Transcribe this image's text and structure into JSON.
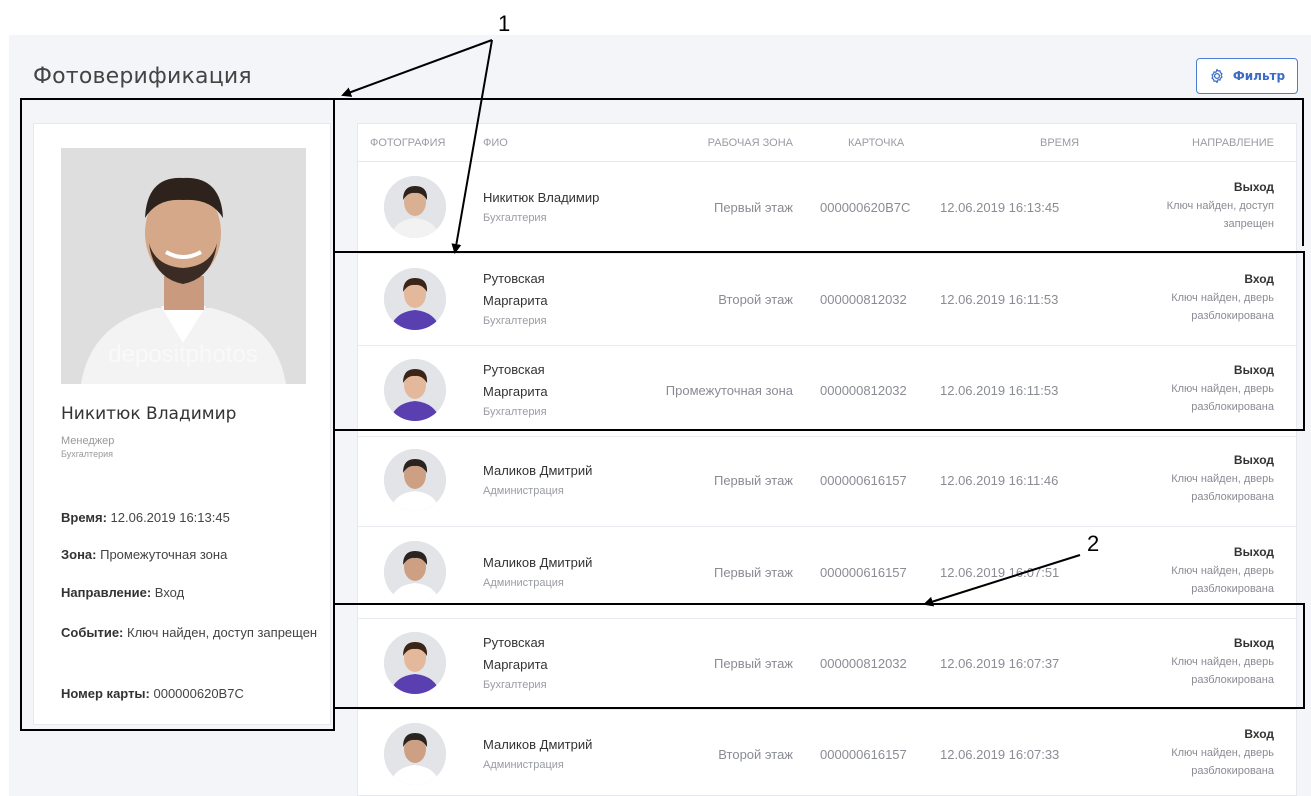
{
  "header": {
    "title": "Фотоверификация",
    "filter_label": "Фильтр"
  },
  "selected": {
    "name": "Никитюк Владимир",
    "role": "Менеджер",
    "department": "Бухгалтерия",
    "fields": [
      {
        "label": "Время:",
        "value": " 12.06.2019 16:13:45"
      },
      {
        "label": "Зона:",
        "value": " Промежуточная зона"
      },
      {
        "label": "Направление:",
        "value": " Вход"
      },
      {
        "label": "Событие:",
        "value": " Ключ найден, доступ запрещен"
      },
      {
        "label": "Номер карты:",
        "value": " 000000620B7C"
      }
    ],
    "watermark": "depositphotos"
  },
  "table": {
    "columns": {
      "photo": "ФОТОГРАФИЯ",
      "fio": "ФИО",
      "zone": "РАБОЧАЯ ЗОНА",
      "card": "КАРТОЧКА",
      "time": "ВРЕМЯ",
      "direction": "НАПРАВЛЕНИЕ"
    },
    "rows": [
      {
        "name": [
          "Никитюк Владимир"
        ],
        "dept": "Бухгалтерия",
        "zone": "Первый этаж",
        "card": "000000620B7C",
        "time": "12.06.2019 16:13:45",
        "dir": "Выход",
        "event": [
          "Ключ найден, доступ",
          "запрещен"
        ]
      },
      {
        "name": [
          "Рутовская",
          "Маргарита"
        ],
        "dept": "Бухгалтерия",
        "zone": "Второй этаж",
        "card": "000000812032",
        "time": "12.06.2019 16:11:53",
        "dir": "Вход",
        "event": [
          "Ключ найден, дверь",
          "разблокирована"
        ]
      },
      {
        "name": [
          "Рутовская",
          "Маргарита"
        ],
        "dept": "Бухгалтерия",
        "zone": "Промежуточная зона",
        "card": "000000812032",
        "time": "12.06.2019 16:11:53",
        "dir": "Выход",
        "event": [
          "Ключ найден, дверь",
          "разблокирована"
        ]
      },
      {
        "name": [
          "Маликов Дмитрий"
        ],
        "dept": "Администрация",
        "zone": "Первый этаж",
        "card": "000000616157",
        "time": "12.06.2019 16:11:46",
        "dir": "Выход",
        "event": [
          "Ключ найден, дверь",
          "разблокирована"
        ]
      },
      {
        "name": [
          "Маликов Дмитрий"
        ],
        "dept": "Администрация",
        "zone": "Первый этаж",
        "card": "000000616157",
        "time": "12.06.2019 16:07:51",
        "dir": "Выход",
        "event": [
          "Ключ найден, дверь",
          "разблокирована"
        ]
      },
      {
        "name": [
          "Рутовская",
          "Маргарита"
        ],
        "dept": "Бухгалтерия",
        "zone": "Первый этаж",
        "card": "000000812032",
        "time": "12.06.2019 16:07:37",
        "dir": "Выход",
        "event": [
          "Ключ найден, дверь",
          "разблокирована"
        ]
      },
      {
        "name": [
          "Маликов Дмитрий"
        ],
        "dept": "Администрация",
        "zone": "Второй этаж",
        "card": "000000616157",
        "time": "12.06.2019 16:07:33",
        "dir": "Вход",
        "event": [
          "Ключ найден, дверь",
          "разблокирована"
        ]
      }
    ]
  },
  "annotations": {
    "label_1": "1",
    "label_2": "2"
  },
  "colors": {
    "accent": "#3a6cc7",
    "background": "#f4f5f8"
  }
}
